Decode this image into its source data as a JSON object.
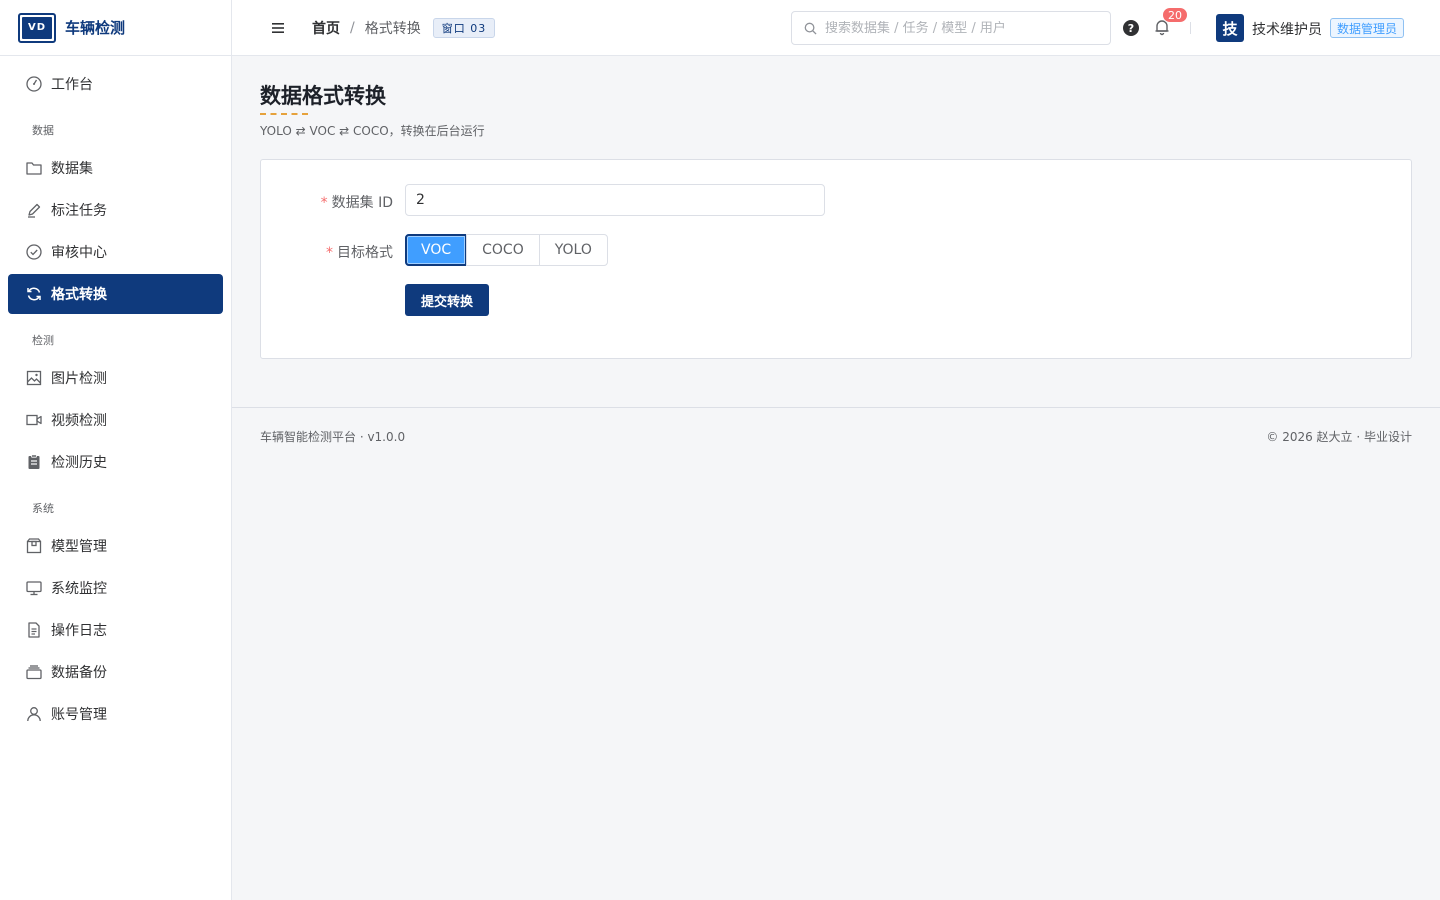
{
  "brand": {
    "logo_text": "VD",
    "name": "车辆检测"
  },
  "sidebar": {
    "items": [
      {
        "type": "item",
        "label": "工作台",
        "icon": "dashboard-icon"
      },
      {
        "type": "group",
        "label": "数据"
      },
      {
        "type": "item",
        "label": "数据集",
        "icon": "folder-icon"
      },
      {
        "type": "item",
        "label": "标注任务",
        "icon": "edit-pen-icon"
      },
      {
        "type": "item",
        "label": "审核中心",
        "icon": "circle-check-icon"
      },
      {
        "type": "item",
        "label": "格式转换",
        "icon": "refresh-icon",
        "active": true
      },
      {
        "type": "group",
        "label": "检测"
      },
      {
        "type": "item",
        "label": "图片检测",
        "icon": "picture-icon"
      },
      {
        "type": "item",
        "label": "视频检测",
        "icon": "video-camera-icon"
      },
      {
        "type": "item",
        "label": "检测历史",
        "icon": "clipboard-icon"
      },
      {
        "type": "group",
        "label": "系统"
      },
      {
        "type": "item",
        "label": "模型管理",
        "icon": "box-icon"
      },
      {
        "type": "item",
        "label": "系统监控",
        "icon": "monitor-icon"
      },
      {
        "type": "item",
        "label": "操作日志",
        "icon": "document-icon"
      },
      {
        "type": "item",
        "label": "数据备份",
        "icon": "stack-icon"
      },
      {
        "type": "item",
        "label": "账号管理",
        "icon": "user-icon"
      }
    ]
  },
  "header": {
    "breadcrumb_home": "首页",
    "breadcrumb_sep": "/",
    "breadcrumb_current": "格式转换",
    "window_badge": "窗口 03",
    "search_placeholder": "搜索数据集 / 任务 / 模型 / 用户",
    "help_glyph": "?",
    "notification_count": "20",
    "avatar_char": "技",
    "username": "技术维护员",
    "role": "数据管理员"
  },
  "main": {
    "title": "数据格式转换",
    "subtitle": "YOLO ⇄ VOC ⇄ COCO，转换在后台运行",
    "form": {
      "dataset_label": "数据集 ID",
      "dataset_value": "2",
      "format_label": "目标格式",
      "format_options": [
        "VOC",
        "COCO",
        "YOLO"
      ],
      "format_selected": "VOC",
      "submit_label": "提交转换",
      "required_mark": "*"
    }
  },
  "footer": {
    "left": "车辆智能检测平台 · v1.0.0",
    "right": "© 2026 赵大立 · 毕业设计"
  },
  "colors": {
    "primary": "#0f3a7d",
    "accent": "#409eff",
    "danger": "#f56c6c",
    "warning": "#e6a23c"
  }
}
